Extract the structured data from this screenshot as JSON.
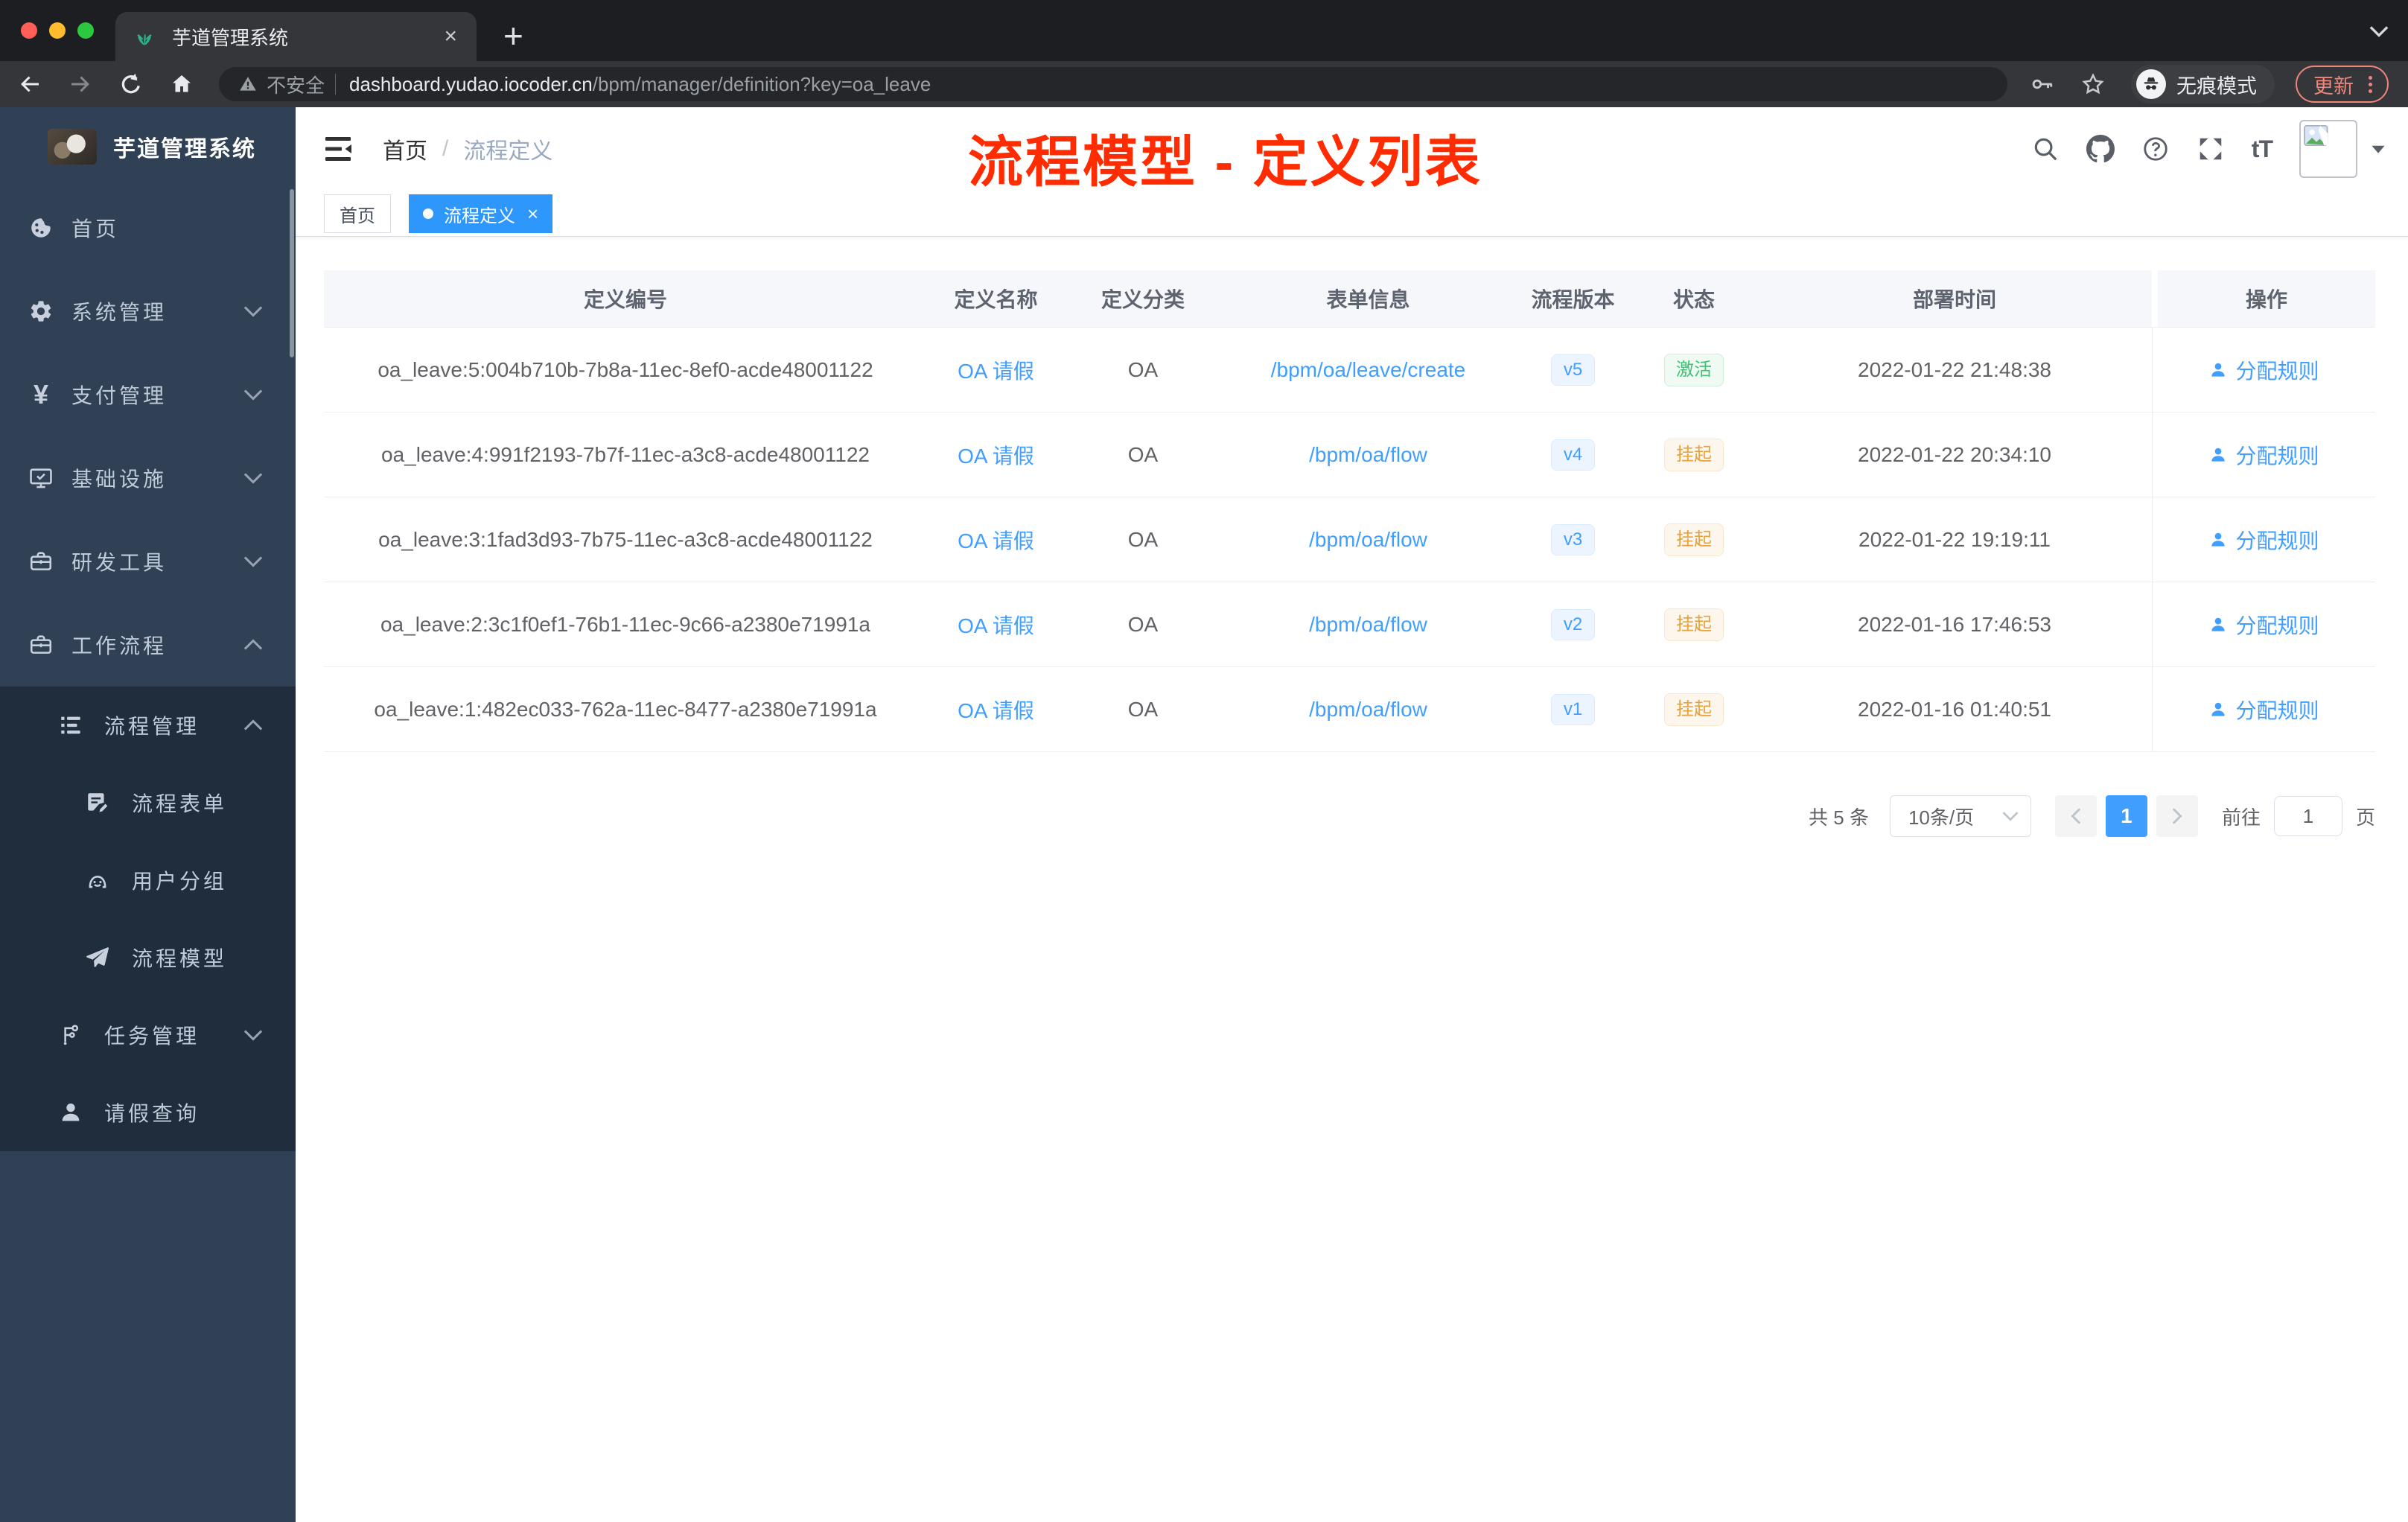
{
  "browser": {
    "tab": {
      "title": "芋道管理系统"
    },
    "new_tab_glyph": "+",
    "security_label": "不安全",
    "url_host": "dashboard.yudao.iocoder.cn",
    "url_path": "/bpm/manager/definition?key=oa_leave",
    "incognito_label": "无痕模式",
    "update_label": "更新"
  },
  "sidebar": {
    "title": "芋道管理系统",
    "items": [
      {
        "label": "首页",
        "icon": "dashboard-icon"
      },
      {
        "label": "系统管理",
        "icon": "gear-icon"
      },
      {
        "label": "支付管理",
        "icon": "yen-icon"
      },
      {
        "label": "基础设施",
        "icon": "monitor-icon"
      },
      {
        "label": "研发工具",
        "icon": "toolbox-icon"
      },
      {
        "label": "工作流程",
        "icon": "briefcase-icon"
      }
    ],
    "submenu": [
      {
        "label": "流程管理",
        "icon": "todo-list-icon"
      },
      {
        "label": "流程表单",
        "icon": "form-edit-icon"
      },
      {
        "label": "用户分组",
        "icon": "robot-icon"
      },
      {
        "label": "流程模型",
        "icon": "paper-plane-icon"
      },
      {
        "label": "任务管理",
        "icon": "org-tree-icon"
      },
      {
        "label": "请假查询",
        "icon": "person-icon"
      }
    ]
  },
  "navbar": {
    "breadcrumb_home": "首页",
    "breadcrumb_separator": "/",
    "breadcrumb_current": "流程定义",
    "font_size_icon_label": "tT"
  },
  "annotation": {
    "text": "流程模型 - 定义列表",
    "color": "#fe2c00"
  },
  "tags_view": {
    "home_tab": "首页",
    "active_tab": "流程定义",
    "close_glyph": "×"
  },
  "table": {
    "columns": [
      "定义编号",
      "定义名称",
      "定义分类",
      "表单信息",
      "流程版本",
      "状态",
      "部署时间",
      "操作"
    ],
    "rows": [
      {
        "id": "oa_leave:5:004b710b-7b8a-11ec-8ef0-acde48001122",
        "name": "OA 请假",
        "category": "OA",
        "form": "/bpm/oa/leave/create",
        "version": "v5",
        "status": "激活",
        "time": "2022-01-22 21:48:38",
        "action": "分配规则"
      },
      {
        "id": "oa_leave:4:991f2193-7b7f-11ec-a3c8-acde48001122",
        "name": "OA 请假",
        "category": "OA",
        "form": "/bpm/oa/flow",
        "version": "v4",
        "status": "挂起",
        "time": "2022-01-22 20:34:10",
        "action": "分配规则"
      },
      {
        "id": "oa_leave:3:1fad3d93-7b75-11ec-a3c8-acde48001122",
        "name": "OA 请假",
        "category": "OA",
        "form": "/bpm/oa/flow",
        "version": "v3",
        "status": "挂起",
        "time": "2022-01-22 19:19:11",
        "action": "分配规则"
      },
      {
        "id": "oa_leave:2:3c1f0ef1-76b1-11ec-9c66-a2380e71991a",
        "name": "OA 请假",
        "category": "OA",
        "form": "/bpm/oa/flow",
        "version": "v2",
        "status": "挂起",
        "time": "2022-01-16 17:46:53",
        "action": "分配规则"
      },
      {
        "id": "oa_leave:1:482ec033-762a-11ec-8477-a2380e71991a",
        "name": "OA 请假",
        "category": "OA",
        "form": "/bpm/oa/flow",
        "version": "v1",
        "status": "挂起",
        "time": "2022-01-16 01:40:51",
        "action": "分配规则"
      }
    ]
  },
  "pagination": {
    "total": "共 5 条",
    "page_size": "10条/页",
    "current_page": "1",
    "goto_label": "前往",
    "goto_value": "1",
    "unit_label": "页"
  },
  "colors": {
    "primary": "#409eff",
    "success_text": "#3fc373",
    "warning_text": "#e6a23c",
    "annotation": "#fe2c00",
    "sidebar_bg": "#304156",
    "submenu_bg": "#1f2d3d",
    "active_tag_bg": "#2e97fc"
  }
}
